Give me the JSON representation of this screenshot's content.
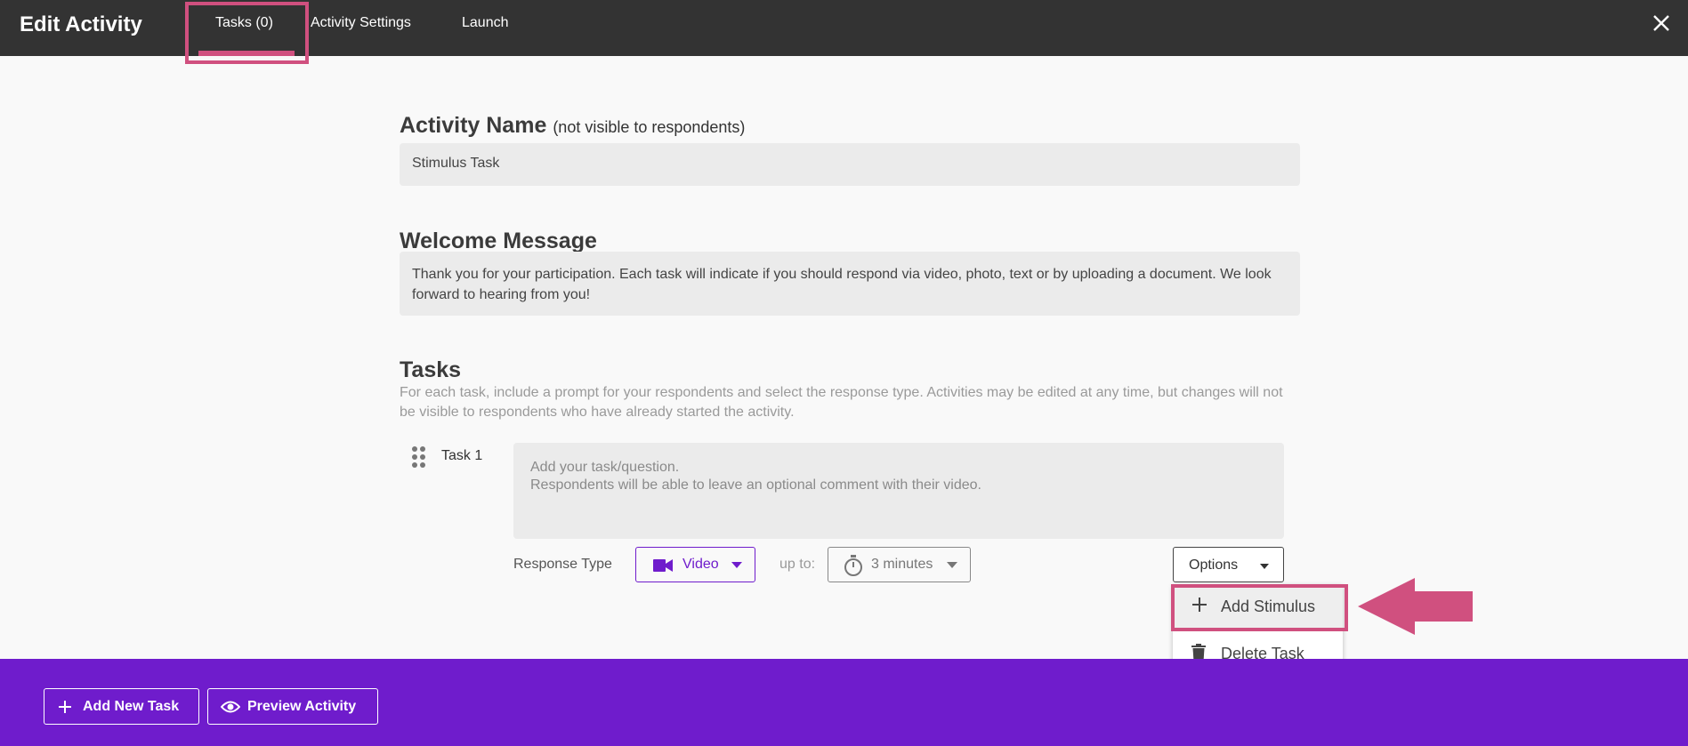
{
  "header": {
    "title": "Edit Activity",
    "tabs": [
      {
        "label": "Tasks (0)",
        "active": true
      },
      {
        "label": "Activity Settings"
      },
      {
        "label": "Launch"
      }
    ],
    "close_icon": "close-icon"
  },
  "activity_name": {
    "title": "Activity Name",
    "note": "(not visible to respondents)",
    "value": "Stimulus Task"
  },
  "welcome": {
    "title": "Welcome Message",
    "value": "Thank you for your participation. Each task will indicate if you should respond via video, photo, text or by uploading a document. We look forward to hearing from you!"
  },
  "tasks": {
    "title": "Tasks",
    "description": "For each task, include a prompt for your respondents and select the response type. Activities may be edited at any time, but changes will not be visible to respondents who have already started the activity.",
    "items": [
      {
        "label": "Task 1",
        "prompt_placeholder_line1": "Add your task/question.",
        "prompt_placeholder_line2": "Respondents will be able to leave an optional comment with their video.",
        "response_type_label": "Response Type",
        "response_type_value": "Video",
        "up_to_label": "up to:",
        "duration_value": "3 minutes",
        "options_label": "Options"
      }
    ]
  },
  "options_menu": {
    "items": [
      {
        "label": "Add Stimulus",
        "icon": "plus-icon"
      },
      {
        "label": "Delete Task",
        "icon": "trash-icon"
      }
    ]
  },
  "footer": {
    "add_task_label": "Add New Task",
    "preview_label": "Preview Activity"
  },
  "colors": {
    "topbar": "#333333",
    "accent_purple": "#6f1ccc",
    "highlight_pink": "#d0507f"
  }
}
